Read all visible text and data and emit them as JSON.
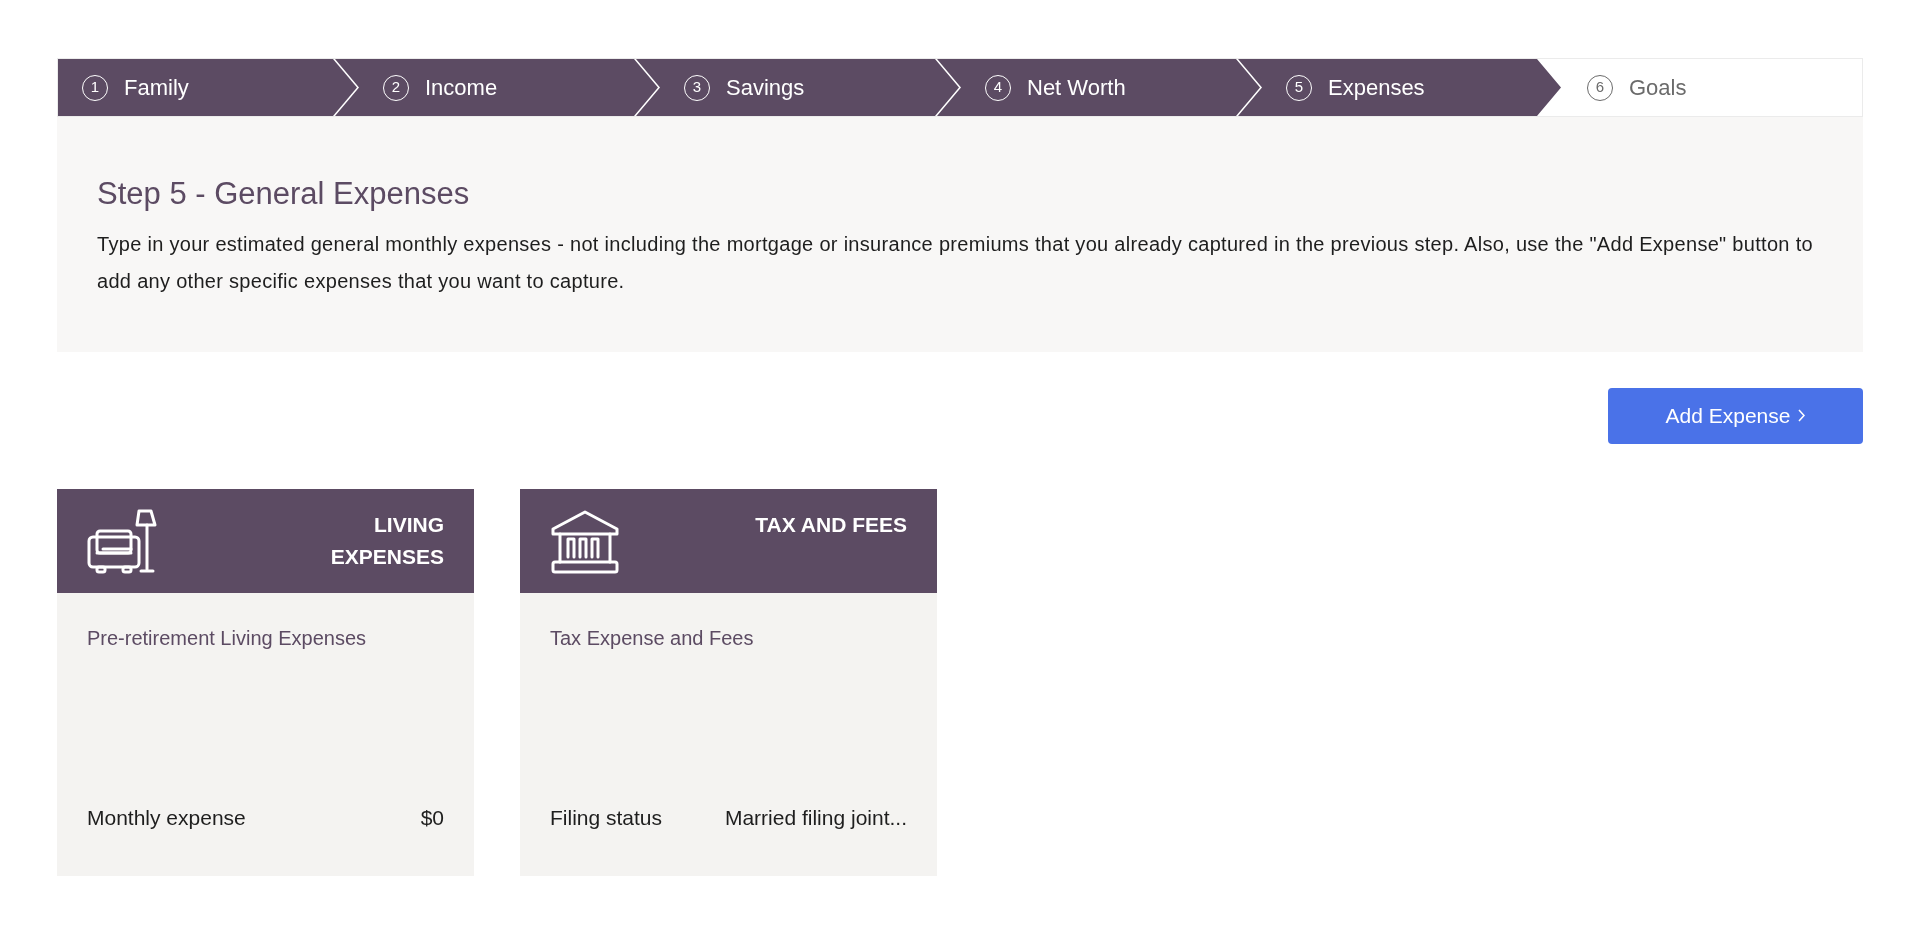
{
  "steps": [
    {
      "number": "1",
      "label": "Family",
      "reached": true
    },
    {
      "number": "2",
      "label": "Income",
      "reached": true
    },
    {
      "number": "3",
      "label": "Savings",
      "reached": true
    },
    {
      "number": "4",
      "label": "Net Worth",
      "reached": true
    },
    {
      "number": "5",
      "label": "Expenses",
      "reached": true
    },
    {
      "number": "6",
      "label": "Goals",
      "reached": false
    }
  ],
  "intro": {
    "title": "Step 5 - General Expenses",
    "text": "Type in your estimated general monthly expenses - not including the mortgage or insurance premiums that you already captured in the previous step. Also, use the \"Add Expense\" button to add any other specific expenses that you want to capture."
  },
  "add_button": {
    "label": "Add Expense"
  },
  "cards": [
    {
      "kind": "living",
      "title": "LIVING EXPENSES",
      "subtitle": "Pre-retirement Living Expenses",
      "field_label": "Monthly expense",
      "field_value": "$0"
    },
    {
      "kind": "tax",
      "title": "TAX AND FEES",
      "subtitle": "Tax Expense and Fees",
      "field_label": "Filing status",
      "field_value": "Married filing joint..."
    }
  ]
}
